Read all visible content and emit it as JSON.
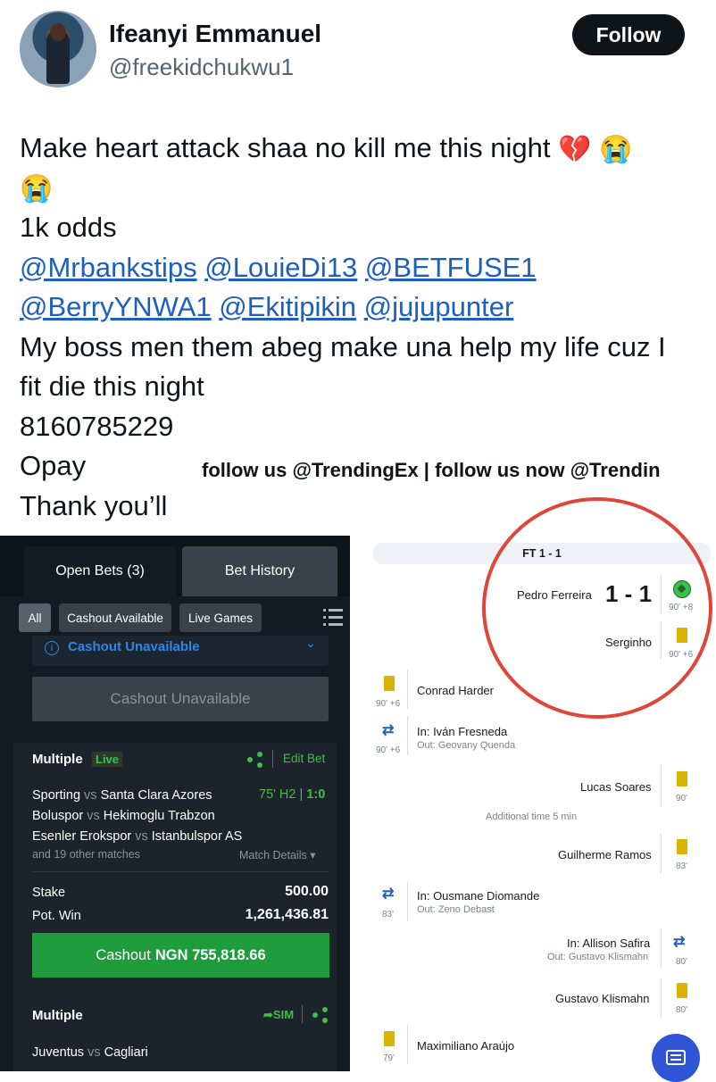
{
  "tweet": {
    "author_name": "Ifeanyi Emmanuel",
    "author_handle": "@freekidchukwu1",
    "follow_label": "Follow",
    "line1": "Make heart attack shaa no kill me this night",
    "emoji_broken_heart": "💔",
    "emoji_crying": "😭",
    "line3": "1k odds",
    "mentions_row1": [
      "@Mrbankstips",
      "@LouieDi13",
      "@BETFUSE1"
    ],
    "mentions_row2": [
      "@BerryYNWA1",
      "@Ekitipikin",
      "@jujupunter"
    ],
    "line6": "My boss men them abeg make una help my life cuz I",
    "line7": "fit die this night",
    "line8": "8160785229",
    "line9": "Opay",
    "line10": "Thank you’ll",
    "watermark": "follow us @TrendingEx | follow us now @Trendin"
  },
  "betslip": {
    "tabs": [
      "Open Bets (3)",
      "Bet History"
    ],
    "filters": [
      "All",
      "Cashout Available",
      "Live Games"
    ],
    "info_icon": "i",
    "cashout_info": "Cashout Unavailable",
    "cashout_disabled_label": "Cashout Unavailable",
    "bet1": {
      "title": "Multiple",
      "badge": "Live",
      "edit_label": "Edit Bet",
      "matches": [
        {
          "home": "Sporting",
          "vs": "vs",
          "away": "Santa Clara Azores"
        },
        {
          "home": "Boluspor",
          "vs": "vs",
          "away": "Hekimoglu Trabzon"
        },
        {
          "home": "Esenler Erokspor",
          "vs": "vs",
          "away": "Istanbulspor AS"
        }
      ],
      "live_status": "75' H2 |",
      "live_score": "1:0",
      "others": "and 19 other matches",
      "details_label": "Match Details",
      "stake_label": "Stake",
      "stake_value": "500.00",
      "potwin_label": "Pot. Win",
      "potwin_value": "1,261,436.81",
      "cashout_prefix": "Cashout",
      "cashout_amount": "NGN 755,818.66"
    },
    "bet2": {
      "title": "Multiple",
      "sim_label": "SIM",
      "match": {
        "home": "Juventus",
        "vs": "vs",
        "away": "Cagliari"
      }
    }
  },
  "timeline": {
    "header": "FT 1 - 1",
    "score": "1 - 1",
    "events": [
      {
        "name": "Pedro Ferreira",
        "minute": "90' +8"
      },
      {
        "name": "Serginho",
        "minute": "90' +6"
      },
      {
        "name": "Conrad Harder",
        "minute": "90' +6"
      },
      {
        "name": "In: Iván Fresneda",
        "sub": "Out: Geovany Quenda",
        "minute": "90' +6"
      },
      {
        "name": "Lucas Soares",
        "minute": "90'"
      },
      {
        "name": "Guilherme Ramos",
        "minute": "83'"
      },
      {
        "name": "In: Ousmane Diomande",
        "sub": "Out: Zeno Debast",
        "minute": "83'"
      },
      {
        "name": "In: Allison Safira",
        "sub": "Out: Gustavo Klismahn",
        "minute": "80'"
      },
      {
        "name": "Gustavo Klismahn",
        "minute": "80'"
      },
      {
        "name": "Maximiliano Araújo",
        "minute": "79'"
      }
    ],
    "additional_time": "Additional time 5 min"
  },
  "colors": {
    "accent_green": "#3fbf4a",
    "cashout_green": "#1e9b3b",
    "link_blue": "#1d5fbf",
    "card_yellow": "#d8b400",
    "highlight_red": "#e0453c"
  }
}
